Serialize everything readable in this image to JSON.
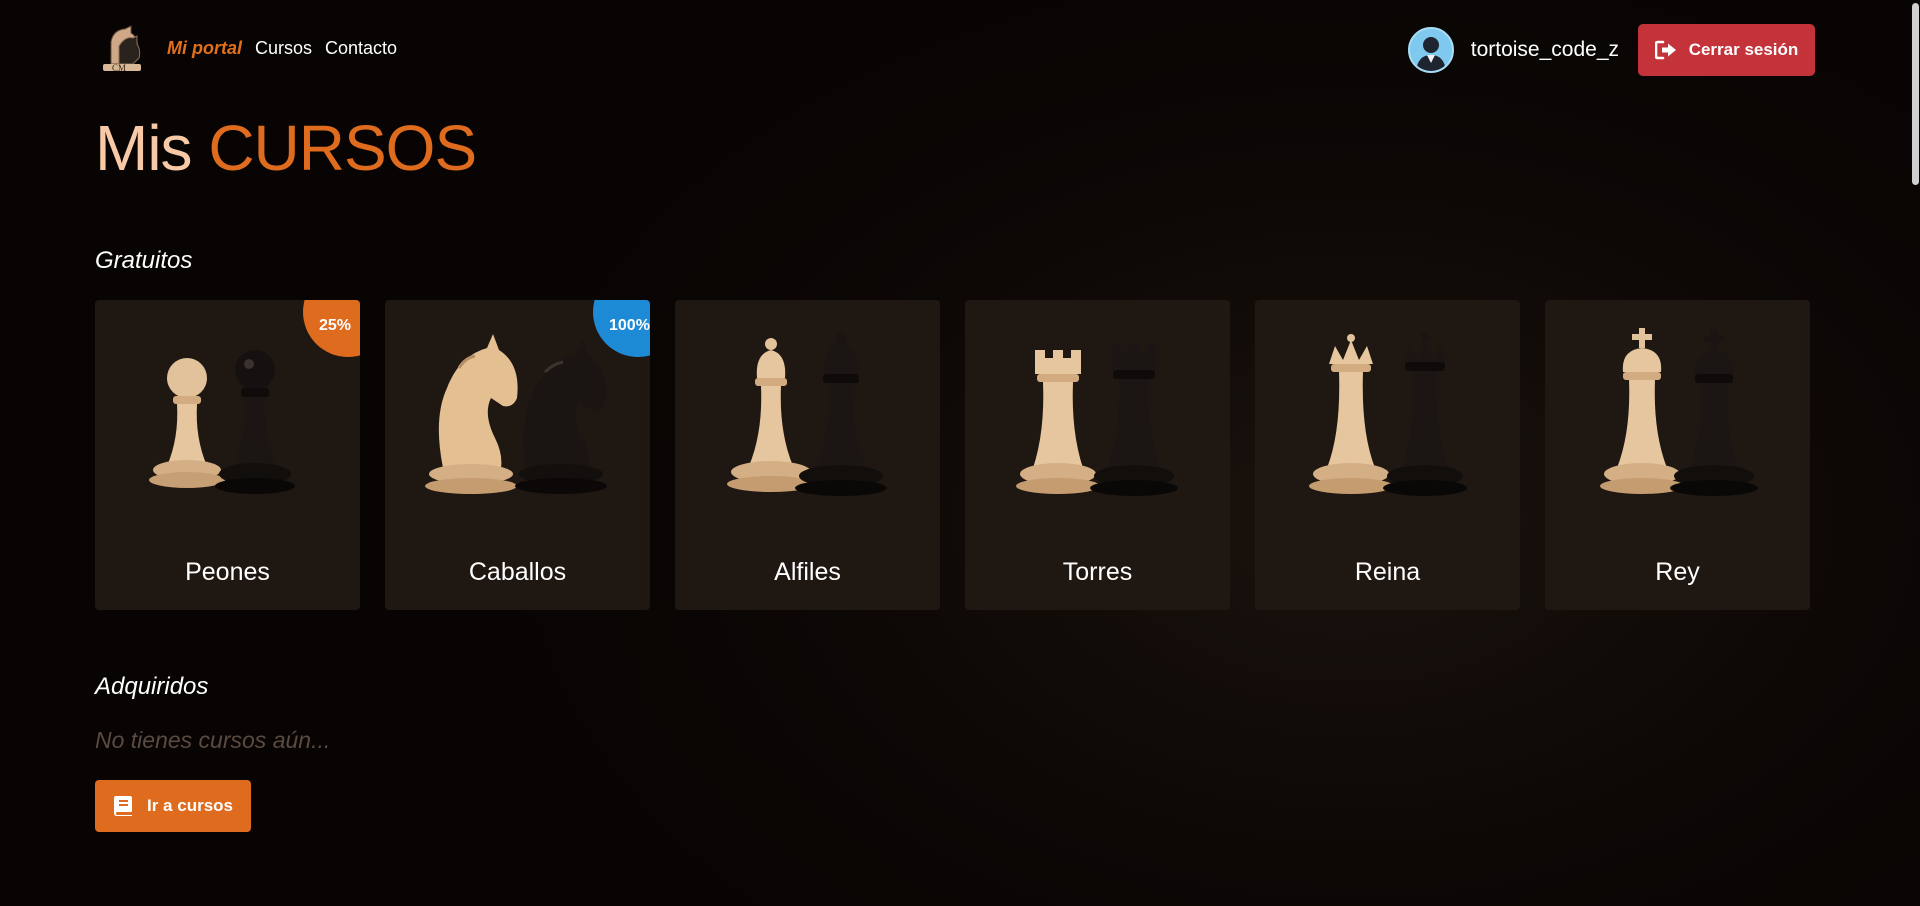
{
  "nav": {
    "logo_text": "CM",
    "items": [
      {
        "label": "Mi portal",
        "active": true
      },
      {
        "label": "Cursos",
        "active": false
      },
      {
        "label": "Contacto",
        "active": false
      }
    ]
  },
  "user": {
    "username": "tortoise_code_z",
    "logout_label": "Cerrar sesión",
    "logout_icon": "sign-out-icon"
  },
  "page_title": {
    "part1": "Mis",
    "part2": "CURSOS"
  },
  "sections": {
    "free": {
      "heading": "Gratuitos",
      "courses": [
        {
          "name": "Peones",
          "piece": "pawn",
          "progress": "25%",
          "badge_color": "#df6c1e"
        },
        {
          "name": "Caballos",
          "piece": "knight",
          "progress": "100%",
          "badge_color": "#1d8ad6"
        },
        {
          "name": "Alfiles",
          "piece": "bishop",
          "progress": null
        },
        {
          "name": "Torres",
          "piece": "rook",
          "progress": null
        },
        {
          "name": "Reina",
          "piece": "queen",
          "progress": null
        },
        {
          "name": "Rey",
          "piece": "king",
          "progress": null
        }
      ]
    },
    "acquired": {
      "heading": "Adquiridos",
      "empty_text": "No tienes cursos aún...",
      "button_label": "Ir a cursos",
      "button_icon": "book-icon"
    }
  },
  "colors": {
    "accent": "#df6c1e",
    "title_light": "#f7c9a6",
    "danger": "#c4323a",
    "complete": "#1d8ad6",
    "card_bg": "#1f1712"
  }
}
